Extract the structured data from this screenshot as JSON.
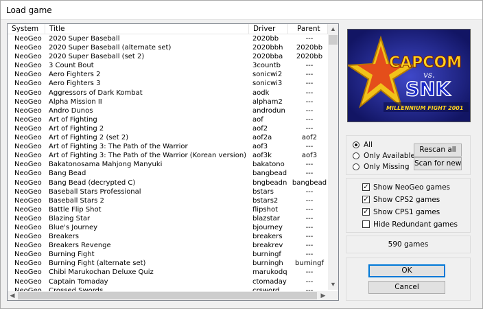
{
  "window": {
    "title": "Load game"
  },
  "list": {
    "columns": {
      "system": "System",
      "title": "Title",
      "driver": "Driver",
      "parent": "Parent"
    },
    "rows": [
      {
        "system": "NeoGeo",
        "title": "2020 Super Baseball",
        "driver": "2020bb",
        "parent": "---"
      },
      {
        "system": "NeoGeo",
        "title": "2020 Super Baseball (alternate set)",
        "driver": "2020bbh",
        "parent": "2020bb"
      },
      {
        "system": "NeoGeo",
        "title": "2020 Super Baseball (set 2)",
        "driver": "2020bba",
        "parent": "2020bb"
      },
      {
        "system": "NeoGeo",
        "title": "3 Count Bout",
        "driver": "3countb",
        "parent": "---"
      },
      {
        "system": "NeoGeo",
        "title": "Aero Fighters 2",
        "driver": "sonicwi2",
        "parent": "---"
      },
      {
        "system": "NeoGeo",
        "title": "Aero Fighters 3",
        "driver": "sonicwi3",
        "parent": "---"
      },
      {
        "system": "NeoGeo",
        "title": "Aggressors of Dark Kombat",
        "driver": "aodk",
        "parent": "---"
      },
      {
        "system": "NeoGeo",
        "title": "Alpha Mission II",
        "driver": "alpham2",
        "parent": "---"
      },
      {
        "system": "NeoGeo",
        "title": "Andro Dunos",
        "driver": "androdun",
        "parent": "---"
      },
      {
        "system": "NeoGeo",
        "title": "Art of Fighting",
        "driver": "aof",
        "parent": "---"
      },
      {
        "system": "NeoGeo",
        "title": "Art of Fighting 2",
        "driver": "aof2",
        "parent": "---"
      },
      {
        "system": "NeoGeo",
        "title": "Art of Fighting 2 (set 2)",
        "driver": "aof2a",
        "parent": "aof2"
      },
      {
        "system": "NeoGeo",
        "title": "Art of Fighting 3: The Path of the Warrior",
        "driver": "aof3",
        "parent": "---"
      },
      {
        "system": "NeoGeo",
        "title": "Art of Fighting 3: The Path of the Warrior (Korean version)",
        "driver": "aof3k",
        "parent": "aof3"
      },
      {
        "system": "NeoGeo",
        "title": "Bakatonosama Mahjong Manyuki",
        "driver": "bakatono",
        "parent": "---"
      },
      {
        "system": "NeoGeo",
        "title": "Bang Bead",
        "driver": "bangbead",
        "parent": "---"
      },
      {
        "system": "NeoGeo",
        "title": "Bang Bead (decrypted C)",
        "driver": "bngbeadn",
        "parent": "bangbead"
      },
      {
        "system": "NeoGeo",
        "title": "Baseball Stars Professional",
        "driver": "bstars",
        "parent": "---"
      },
      {
        "system": "NeoGeo",
        "title": "Baseball Stars 2",
        "driver": "bstars2",
        "parent": "---"
      },
      {
        "system": "NeoGeo",
        "title": "Battle Flip Shot",
        "driver": "flipshot",
        "parent": "---"
      },
      {
        "system": "NeoGeo",
        "title": "Blazing Star",
        "driver": "blazstar",
        "parent": "---"
      },
      {
        "system": "NeoGeo",
        "title": "Blue's Journey",
        "driver": "bjourney",
        "parent": "---"
      },
      {
        "system": "NeoGeo",
        "title": "Breakers",
        "driver": "breakers",
        "parent": "---"
      },
      {
        "system": "NeoGeo",
        "title": "Breakers Revenge",
        "driver": "breakrev",
        "parent": "---"
      },
      {
        "system": "NeoGeo",
        "title": "Burning Fight",
        "driver": "burningf",
        "parent": "---"
      },
      {
        "system": "NeoGeo",
        "title": "Burning Fight (alternate set)",
        "driver": "burningh",
        "parent": "burningf"
      },
      {
        "system": "NeoGeo",
        "title": "Chibi Marukochan Deluxe Quiz",
        "driver": "marukodq",
        "parent": "---"
      },
      {
        "system": "NeoGeo",
        "title": "Captain Tomaday",
        "driver": "ctomaday",
        "parent": "---"
      },
      {
        "system": "NeoGeo",
        "title": "Crossed Swords",
        "driver": "crsword",
        "parent": "---"
      }
    ]
  },
  "preview": {
    "logo_text": "CAPCOM vs. SNK",
    "subtitle": "MILLENNIUM FIGHT 2001"
  },
  "filter": {
    "options": [
      "All",
      "Only Available",
      "Only Missing"
    ],
    "selected": "All",
    "rescan_label": "Rescan all",
    "scan_new_label": "Scan for new"
  },
  "show": {
    "items": [
      {
        "label": "Show NeoGeo games",
        "checked": true
      },
      {
        "label": "Show CPS2 games",
        "checked": true
      },
      {
        "label": "Show CPS1 games",
        "checked": true
      },
      {
        "label": "Hide Redundant games",
        "checked": false
      }
    ]
  },
  "count": {
    "text": "590 games"
  },
  "actions": {
    "ok_label": "OK",
    "cancel_label": "Cancel"
  },
  "colors": {
    "accent": "#0078d7",
    "preview_bg": "#1a1d7a"
  }
}
